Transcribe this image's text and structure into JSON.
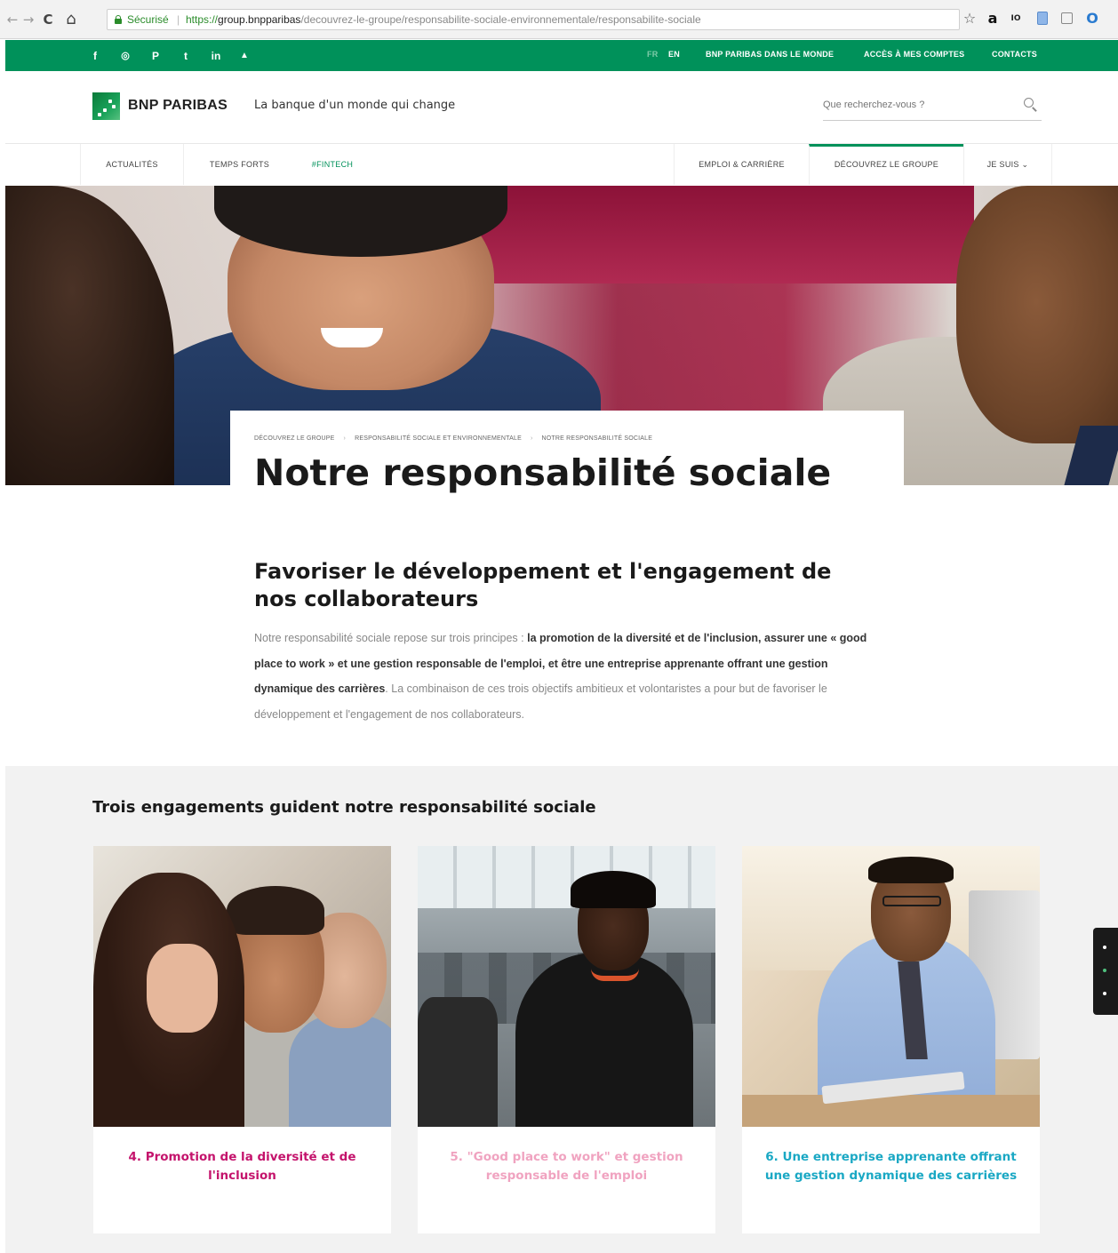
{
  "browser": {
    "secure_label": "Sécurisé",
    "url_proto": "https://",
    "url_host": "group.bnpparibas",
    "url_path": "/decouvrez-le-groupe/responsabilite-sociale-environnementale/responsabilite-sociale",
    "back_icon": "←",
    "forward_icon": "→",
    "reload_icon": "C",
    "home_icon": "⌂",
    "star_icon": "☆",
    "amazon_icon": "a",
    "ext2_icon": "IO",
    "ext5_icon": "O"
  },
  "topbar": {
    "social": [
      "f",
      "◎",
      "P",
      "t",
      "in",
      "▲"
    ],
    "lang_fr": "FR",
    "lang_en": "EN",
    "link_world": "BNP PARIBAS DANS LE MONDE",
    "link_accounts": "ACCÈS À MES COMPTES",
    "link_contacts": "CONTACTS"
  },
  "header": {
    "logo_text": "BNP PARIBAS",
    "tagline": "La banque d'un monde qui change",
    "search_placeholder": "Que recherchez-vous ?"
  },
  "nav": {
    "items": [
      {
        "label": "ACTUALITÉS"
      },
      {
        "label": "TEMPS FORTS"
      },
      {
        "label": "#FINTECH"
      },
      {
        "label": "EMPLOI & CARRIÈRE"
      },
      {
        "label": "DÉCOUVREZ LE GROUPE"
      },
      {
        "label": "JE SUIS ⌄"
      }
    ]
  },
  "hero": {
    "breadcrumb": [
      "DÉCOUVREZ LE GROUPE",
      "RESPONSABILITÉ SOCIALE ET ENVIRONNEMENTALE",
      "NOTRE RESPONSABILITÉ SOCIALE"
    ],
    "breadcrumb_sep": "›",
    "title": "Notre responsabilité sociale"
  },
  "intro": {
    "title": "Favoriser le développement et l'engagement de nos collaborateurs",
    "text_1": "Notre responsabilité sociale repose sur trois principes : ",
    "text_bold": "la promotion de la diversité et de l'inclusion, assurer une « good place to work » et une gestion responsable de l'emploi, et être une entreprise apprenante offrant une gestion dynamique des carrières",
    "text_2": ". La combinaison de ces trois objectifs ambitieux et volontaristes a pour but de favoriser le développement et l'engagement de nos collaborateurs."
  },
  "engagements": {
    "title": "Trois engagements guident notre responsabilité sociale",
    "cards": [
      {
        "caption": "4. Promotion de la diversité et de l'inclusion",
        "color": "#c4136c"
      },
      {
        "caption": "5. \"Good place to work\" et gestion responsable de l'emploi",
        "color": "#f0a3c0"
      },
      {
        "caption": "6. Une entreprise apprenante offrant une gestion dynamique des carrières",
        "color": "#1aa8c4"
      }
    ]
  },
  "colors": {
    "brand_green": "#00915a",
    "grey_bg": "#f2f2f2"
  }
}
